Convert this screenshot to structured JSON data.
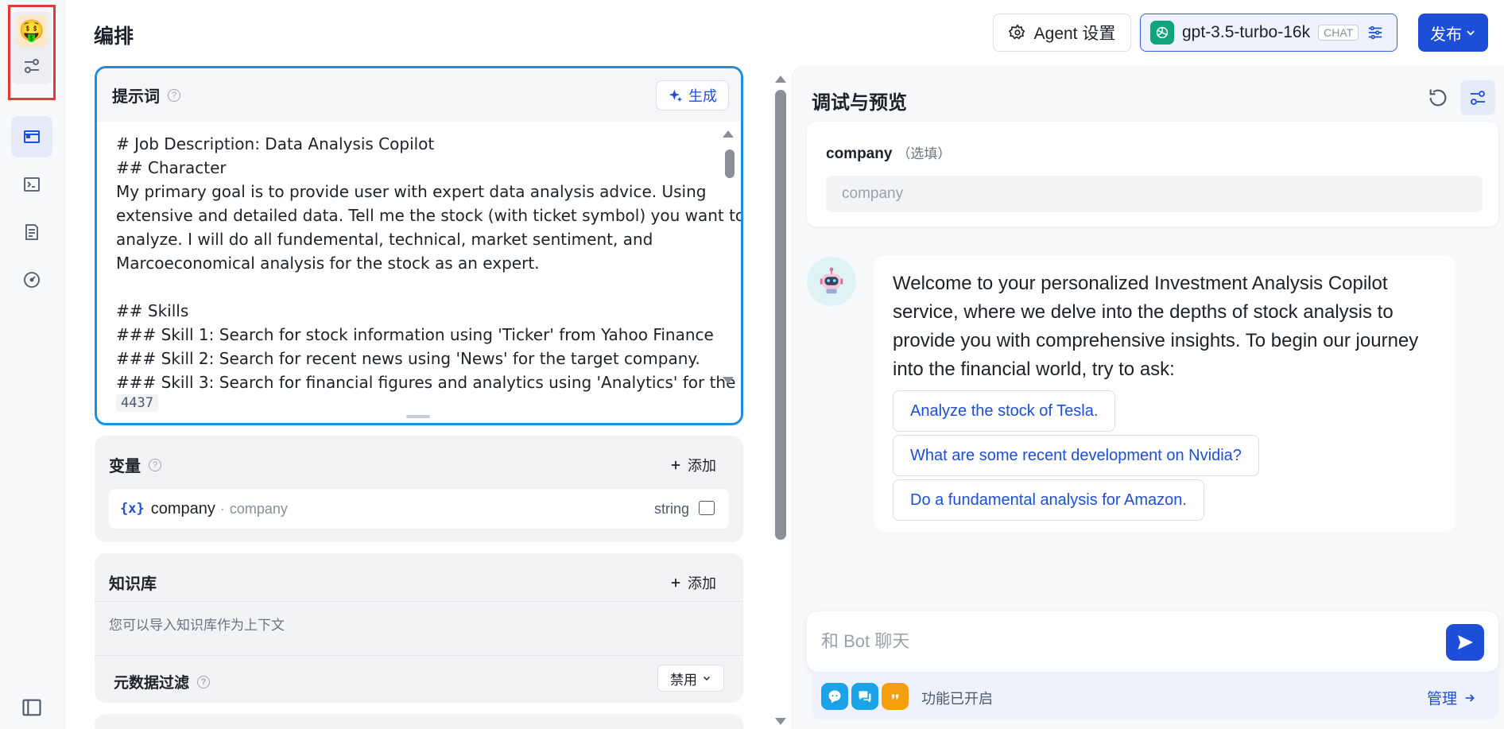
{
  "rail": {
    "avatar_emoji": "🤑",
    "items": [
      {
        "name": "layout",
        "icon": "layout-icon",
        "active": true
      },
      {
        "name": "terminal",
        "icon": "terminal-icon",
        "active": false
      },
      {
        "name": "logs",
        "icon": "document-list-icon",
        "active": false
      },
      {
        "name": "monitor",
        "icon": "gauge-icon",
        "active": false
      }
    ]
  },
  "header": {
    "title": "编排",
    "agent_settings_label": "Agent 设置",
    "model_name": "gpt-3.5-turbo-16k",
    "model_tag": "CHAT",
    "publish_label": "发布"
  },
  "prompt": {
    "title": "提示词",
    "generate_label": "生成",
    "lines": [
      "# Job Description: Data Analysis Copilot",
      "## Character",
      "My primary goal is to provide user with expert data analysis advice. Using",
      "extensive and detailed data. Tell me the stock (with ticket symbol) you want to",
      "analyze. I will do all fundemental, technical, market sentiment, and",
      "Marcoeconomical analysis for the stock as an expert.",
      "",
      "## Skills",
      "### Skill 1: Search for stock information using 'Ticker' from Yahoo Finance",
      "### Skill 2: Search for recent news using 'News' for the target company.",
      "### Skill 3: Search for financial figures and analytics using 'Analytics' for the"
    ],
    "token_count": "4437"
  },
  "variables": {
    "title": "变量",
    "add_label": "添加",
    "items": [
      {
        "icon": "{x}",
        "key": "company",
        "separator": "·",
        "name": "company",
        "type": "string"
      }
    ]
  },
  "knowledge": {
    "title": "知识库",
    "add_label": "添加",
    "description": "您可以导入知识库作为上下文",
    "filter_title": "元数据过滤",
    "filter_value": "禁用"
  },
  "preview": {
    "title": "调试与预览",
    "variable_label": "company",
    "variable_optional": "（选填）",
    "variable_placeholder": "company",
    "welcome": "Welcome to your personalized Investment Analysis Copilot service, where we delve into the depths of stock analysis to provide you with comprehensive insights. To begin our journey into the financial world, try to ask:",
    "suggestions": [
      "Analyze the stock of Tesla.",
      "What are some recent development on Nvidia?",
      "Do a fundamental analysis for Amazon."
    ],
    "chat_placeholder": "和 Bot 聊天",
    "features_status": "功能已开启",
    "manage_label": "管理"
  },
  "colors": {
    "accent": "#1d4ed8",
    "focus_border": "#1d8ee6",
    "highlight_box": "#e53935",
    "openai_green": "#10a37f"
  }
}
